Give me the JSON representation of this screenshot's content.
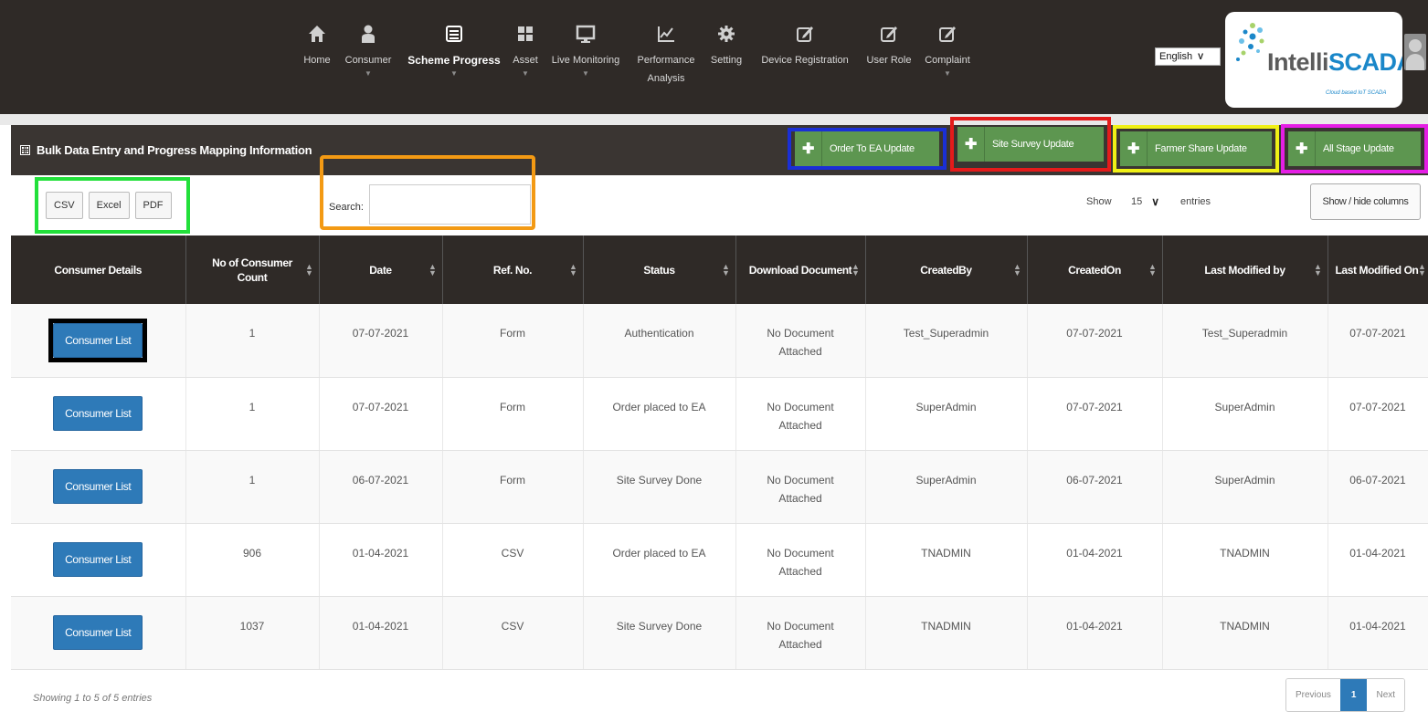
{
  "nav": {
    "items": [
      {
        "label": "Home",
        "icon": "home-icon",
        "caret": false,
        "active": false
      },
      {
        "label": "Consumer",
        "icon": "user-icon",
        "caret": true,
        "active": false
      },
      {
        "label": "Scheme Progress",
        "icon": "list-icon",
        "caret": true,
        "active": true
      },
      {
        "label": "Asset",
        "icon": "grid-icon",
        "caret": true,
        "active": false
      },
      {
        "label": "Live Monitoring",
        "icon": "monitor-icon",
        "caret": true,
        "active": false
      },
      {
        "label": "Performance Analysis",
        "icon": "chart-icon",
        "caret": false,
        "active": false
      },
      {
        "label": "Setting",
        "icon": "gear-icon",
        "caret": false,
        "active": false
      },
      {
        "label": "Device Registration",
        "icon": "edit-icon",
        "caret": false,
        "active": false
      },
      {
        "label": "User Role",
        "icon": "edit-icon",
        "caret": false,
        "active": false
      },
      {
        "label": "Complaint",
        "icon": "edit-icon",
        "caret": true,
        "active": false
      }
    ],
    "language": "English",
    "logo_text_dark": "Intelli",
    "logo_text_accent": "SCADA",
    "logo_subtitle": "Cloud based IoT SCADA"
  },
  "panel": {
    "title": "Bulk Data Entry and Progress Mapping Information",
    "buttons": {
      "order_to_ea": "Order To EA Update",
      "site_survey": "Site Survey Update",
      "farmer_share": "Farmer Share Update",
      "all_stage": "All Stage Update"
    },
    "highlight_colors": {
      "order_to_ea": "#1a2fd6",
      "site_survey": "#e41b1b",
      "farmer_share": "#f0f016",
      "all_stage": "#e51ee5",
      "export": "#22e03a",
      "search": "#f39a14",
      "first_row_button": "#000000"
    }
  },
  "toolbar": {
    "csv": "CSV",
    "excel": "Excel",
    "pdf": "PDF",
    "search_label": "Search:",
    "search_value": "",
    "show_label": "Show",
    "entries_value": "15",
    "entries_label": "entries",
    "column_visibility": "Show / hide columns"
  },
  "table": {
    "headers": {
      "consumer_details": "Consumer Details",
      "count": "No of Consumer Count",
      "date": "Date",
      "ref_no": "Ref. No.",
      "status": "Status",
      "download": "Download Document",
      "created_by": "CreatedBy",
      "created_on": "CreatedOn",
      "last_modified_by": "Last Modified by",
      "last_modified_on": "Last Modified On"
    },
    "rows": [
      {
        "button": "Consumer List",
        "count": "1",
        "date": "07-07-2021",
        "ref": "Form",
        "status": "Authentication",
        "download": "No Document Attached",
        "created_by": "Test_Superadmin",
        "created_on": "07-07-2021",
        "modified_by": "Test_Superadmin",
        "modified_on": "07-07-2021"
      },
      {
        "button": "Consumer List",
        "count": "1",
        "date": "07-07-2021",
        "ref": "Form",
        "status": "Order placed to EA",
        "download": "No Document Attached",
        "created_by": "SuperAdmin",
        "created_on": "07-07-2021",
        "modified_by": "SuperAdmin",
        "modified_on": "07-07-2021"
      },
      {
        "button": "Consumer List",
        "count": "1",
        "date": "06-07-2021",
        "ref": "Form",
        "status": "Site Survey Done",
        "download": "No Document Attached",
        "created_by": "SuperAdmin",
        "created_on": "06-07-2021",
        "modified_by": "SuperAdmin",
        "modified_on": "06-07-2021"
      },
      {
        "button": "Consumer List",
        "count": "906",
        "date": "01-04-2021",
        "ref": "CSV",
        "status": "Order placed to EA",
        "download": "No Document Attached",
        "created_by": "TNADMIN",
        "created_on": "01-04-2021",
        "modified_by": "TNADMIN",
        "modified_on": "01-04-2021"
      },
      {
        "button": "Consumer List",
        "count": "1037",
        "date": "01-04-2021",
        "ref": "CSV",
        "status": "Site Survey Done",
        "download": "No Document Attached",
        "created_by": "TNADMIN",
        "created_on": "01-04-2021",
        "modified_by": "TNADMIN",
        "modified_on": "01-04-2021"
      }
    ]
  },
  "footer": {
    "info": "Showing 1 to 5 of 5 entries",
    "previous": "Previous",
    "page": "1",
    "next": "Next"
  }
}
